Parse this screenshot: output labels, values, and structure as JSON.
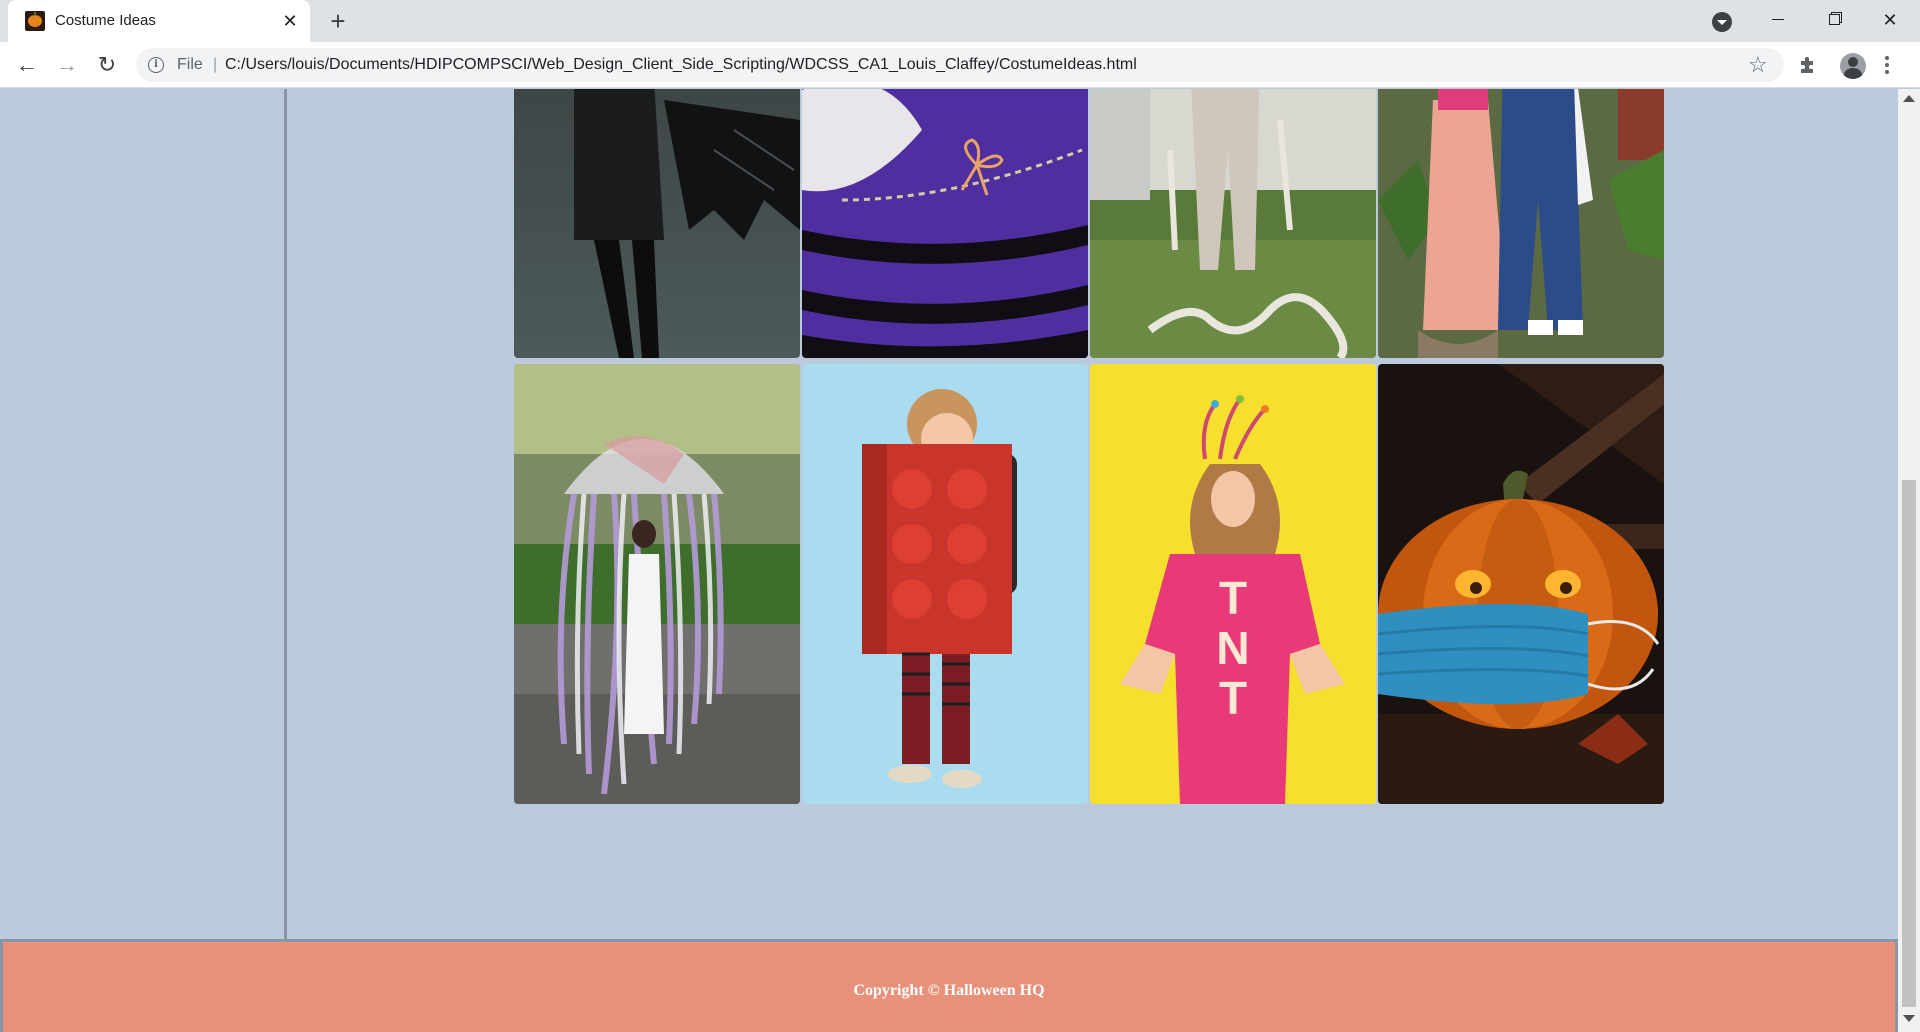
{
  "browser": {
    "tab": {
      "title": "Costume Ideas",
      "favicon": "pumpkin-favicon",
      "close_glyph": "✕"
    },
    "new_tab_glyph": "+",
    "window_controls": {
      "close_glyph": "✕"
    },
    "toolbar": {
      "back_glyph": "←",
      "forward_glyph": "→",
      "reload_glyph": "↻",
      "address": {
        "scheme_label": "File",
        "separator": "|",
        "url": "C:/Users/louis/Documents/HDIPCOMPSCI/Web_Design_Client_Side_Scripting/WDCSS_CA1_Louis_Claffey/CostumeIdeas.html"
      },
      "bookmark_glyph": "☆"
    }
  },
  "gallery": {
    "images": [
      {
        "name": "bat-costume",
        "description": "bat"
      },
      {
        "name": "witch-knit-costume",
        "description": "witch"
      },
      {
        "name": "mummy-costume",
        "description": "mummy"
      },
      {
        "name": "couple-costume",
        "description": "couple"
      },
      {
        "name": "jellyfish-umbrella-costume",
        "description": "jellyfish"
      },
      {
        "name": "lego-brick-costume",
        "description": "lego"
      },
      {
        "name": "tnt-dress-costume",
        "description": "tnt"
      },
      {
        "name": "masked-pumpkin",
        "description": "pumpkin"
      }
    ],
    "tnt_letters": "TNT"
  },
  "footer": {
    "copyright": "Copyright © Halloween HQ"
  },
  "colors": {
    "page_background": "#bccadd",
    "footer_background": "#e8917a",
    "border": "#8a96a4"
  }
}
